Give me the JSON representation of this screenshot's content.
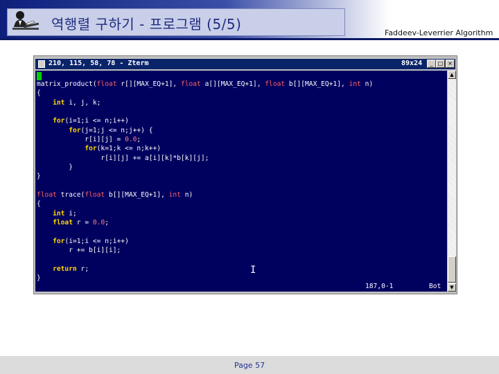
{
  "slide": {
    "title": "역행렬 구하기 - 프로그램 (5/5)",
    "right_title": "Faddeev-Leverrier Algorithm",
    "page_label": "Page 57"
  },
  "terminal": {
    "title": "210, 115, 58, 78 - Zterm",
    "size": "89x24",
    "buttons": {
      "minimize": "_",
      "maximize": "□",
      "close": "×"
    },
    "code_lines": [
      [
        [
          "matrix_product(",
          ""
        ],
        [
          "float",
          "ty"
        ],
        [
          " r[][MAX_EQ+1], ",
          ""
        ],
        [
          "float",
          "ty"
        ],
        [
          " a[][MAX_EQ+1], ",
          ""
        ],
        [
          "float",
          "ty"
        ],
        [
          " b[][MAX_EQ+1], ",
          ""
        ],
        [
          "int",
          "ty"
        ],
        [
          " n)",
          ""
        ]
      ],
      [
        [
          "{",
          ""
        ]
      ],
      [
        [
          "    ",
          ""
        ],
        [
          "int",
          "kw"
        ],
        [
          " i, j, k;",
          ""
        ]
      ],
      [
        [
          "",
          ""
        ]
      ],
      [
        [
          "    ",
          ""
        ],
        [
          "for",
          "kw"
        ],
        [
          "(i=1;i <= n;i++)",
          ""
        ]
      ],
      [
        [
          "        ",
          ""
        ],
        [
          "for",
          "kw"
        ],
        [
          "(j=1;j <= n;j++) {",
          ""
        ]
      ],
      [
        [
          "            r[i][j] = ",
          ""
        ],
        [
          "0.0",
          "num"
        ],
        [
          ";",
          ""
        ]
      ],
      [
        [
          "            ",
          ""
        ],
        [
          "for",
          "kw"
        ],
        [
          "(k=1;k <= n;k++)",
          ""
        ]
      ],
      [
        [
          "                r[i][j] += a[i][k]*b[k][j];",
          ""
        ]
      ],
      [
        [
          "        }",
          ""
        ]
      ],
      [
        [
          "}",
          ""
        ]
      ],
      [
        [
          "",
          ""
        ]
      ],
      [
        [
          "float",
          "ty"
        ],
        [
          " trace(",
          ""
        ],
        [
          "float",
          "ty"
        ],
        [
          " b[][MAX_EQ+1], ",
          ""
        ],
        [
          "int",
          "ty"
        ],
        [
          " n)",
          ""
        ]
      ],
      [
        [
          "{",
          ""
        ]
      ],
      [
        [
          "    ",
          ""
        ],
        [
          "int",
          "kw"
        ],
        [
          " i;",
          ""
        ]
      ],
      [
        [
          "    ",
          ""
        ],
        [
          "float",
          "kw"
        ],
        [
          " r = ",
          ""
        ],
        [
          "0.0",
          "num"
        ],
        [
          ";",
          ""
        ]
      ],
      [
        [
          "",
          ""
        ]
      ],
      [
        [
          "    ",
          ""
        ],
        [
          "for",
          "kw"
        ],
        [
          "(i=1;i <= n;i++)",
          ""
        ]
      ],
      [
        [
          "        r += b[i][i];",
          ""
        ]
      ],
      [
        [
          "",
          ""
        ]
      ],
      [
        [
          "    ",
          ""
        ],
        [
          "return",
          "kw"
        ],
        [
          " r;",
          ""
        ]
      ],
      [
        [
          "}",
          ""
        ]
      ]
    ],
    "status_position": "187,0-1",
    "status_mode": "Bot"
  },
  "colors": {
    "terminal_bg": "#00005f",
    "titlebar": "#0a246a",
    "keyword": "#ffd700",
    "type": "#ff6060",
    "number": "#ff8080"
  }
}
